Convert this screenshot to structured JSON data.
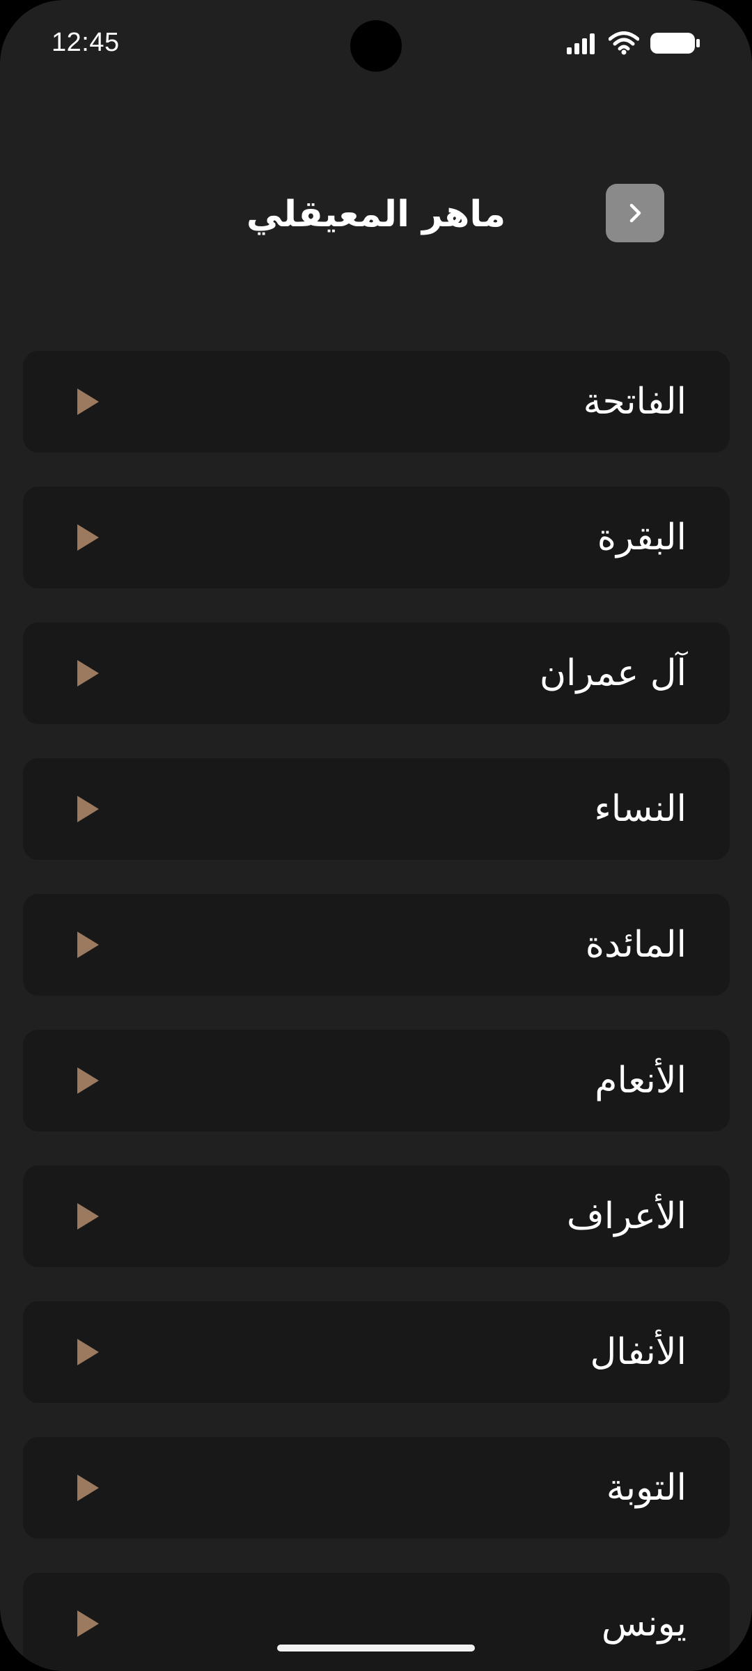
{
  "status_bar": {
    "time": "12:45",
    "icons": [
      "signal-icon",
      "wifi-icon",
      "battery-icon"
    ]
  },
  "header": {
    "title": "ماهر المعيقلي",
    "back_icon": "chevron-right-icon"
  },
  "surahs": [
    {
      "name": "الفاتحة"
    },
    {
      "name": "البقرة"
    },
    {
      "name": "آل عمران"
    },
    {
      "name": "النساء"
    },
    {
      "name": "المائدة"
    },
    {
      "name": "الأنعام"
    },
    {
      "name": "الأعراف"
    },
    {
      "name": "الأنفال"
    },
    {
      "name": "التوبة"
    },
    {
      "name": "يونس"
    }
  ],
  "colors": {
    "background": "#202020",
    "row_background": "#181818",
    "play_icon": "#9b7a60",
    "back_button": "#8a8a8a",
    "text": "#ffffff"
  }
}
